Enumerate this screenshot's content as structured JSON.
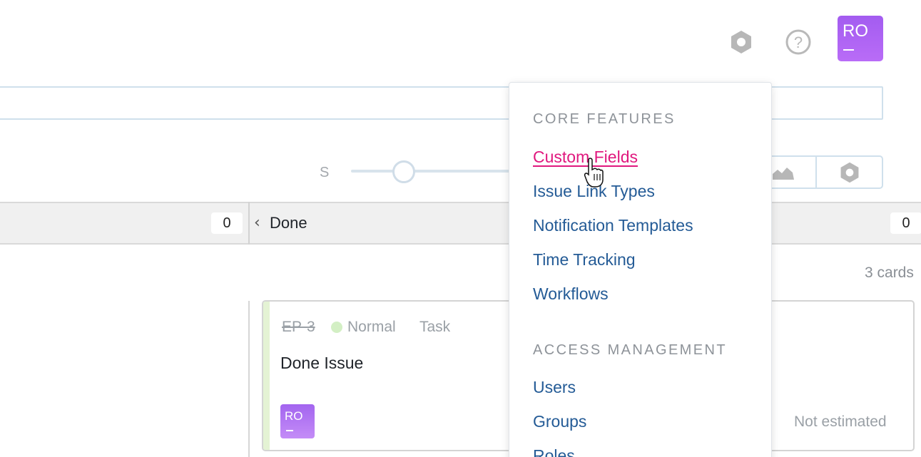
{
  "header": {
    "settings_icon": "gear-icon",
    "help_icon": "help-icon",
    "avatar_initials": "RO"
  },
  "toolbar": {
    "size_label": "S",
    "size_value_fraction": 0.3
  },
  "columns": [
    {
      "count": "0"
    },
    {
      "title": "Done",
      "count": "0"
    }
  ],
  "board": {
    "cards_count": "3 cards"
  },
  "card": {
    "id": "EP-3",
    "priority": "Normal",
    "type": "Task",
    "title": "Done Issue",
    "assignee_initials": "RO",
    "estimate": "Not estimated"
  },
  "menu": {
    "sections": [
      {
        "title": "CORE FEATURES",
        "items": [
          "Custom Fields",
          "Issue Link Types",
          "Notification Templates",
          "Time Tracking",
          "Workflows"
        ]
      },
      {
        "title": "ACCESS MANAGEMENT",
        "items": [
          "Users",
          "Groups",
          "Roles"
        ]
      }
    ],
    "active_item": "Custom Fields"
  },
  "colors": {
    "link": "#245b96",
    "active_link": "#e0187e",
    "avatar": "#a35cf0",
    "priority_dot": "#d3efc4"
  }
}
